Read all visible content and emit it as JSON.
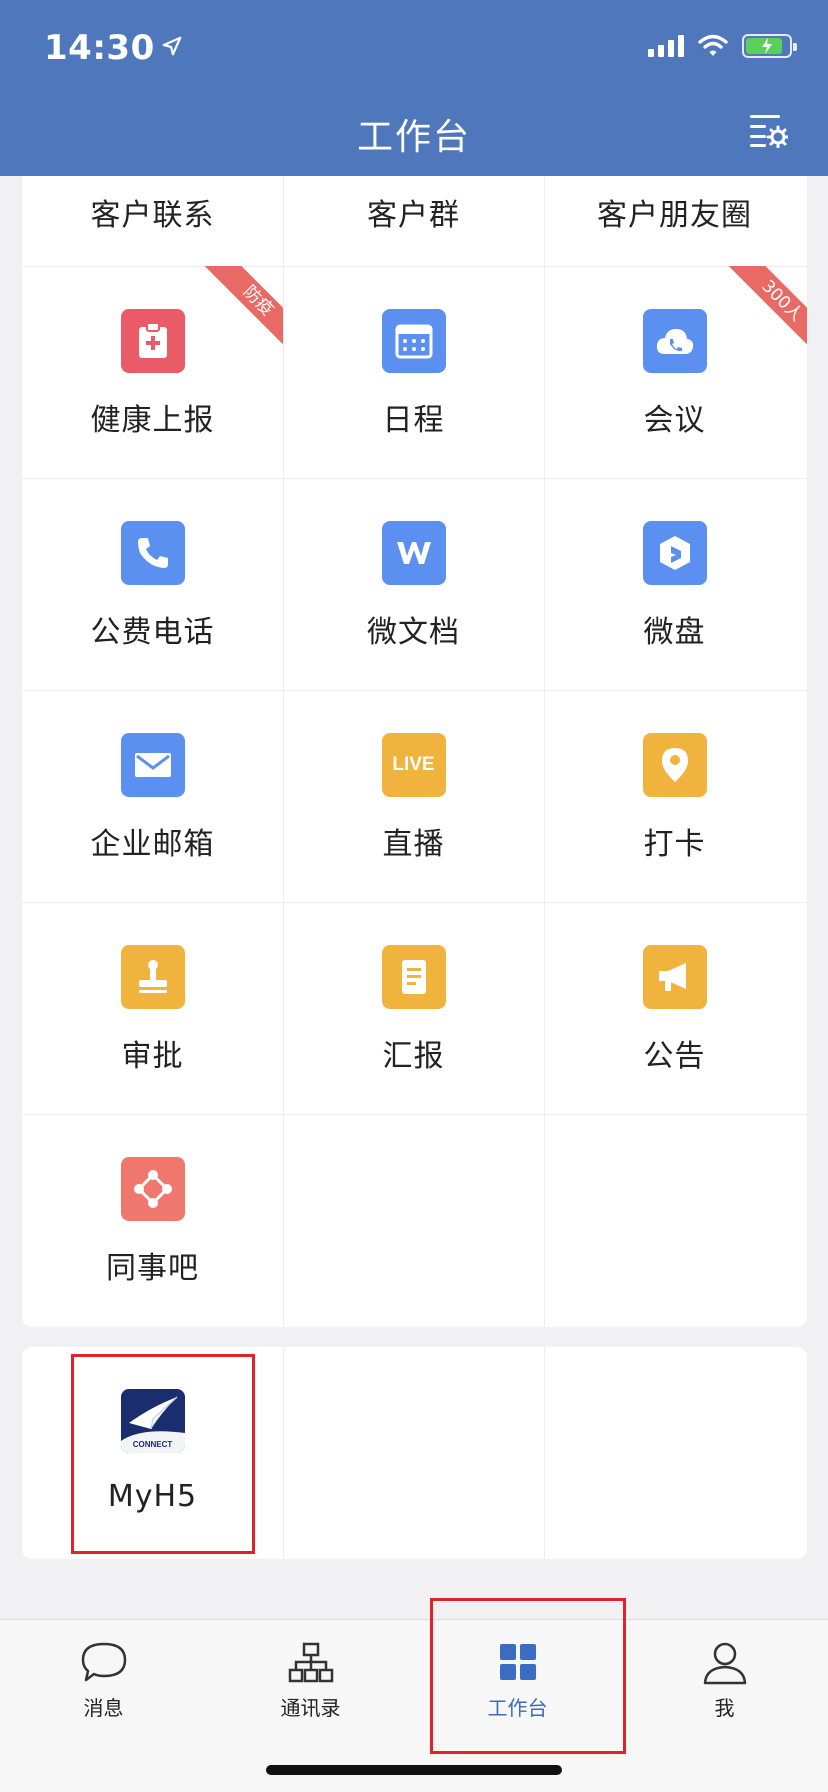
{
  "status_bar": {
    "time": "14:30"
  },
  "header": {
    "title": "工作台"
  },
  "top_row": [
    "客户联系",
    "客户群",
    "客户朋友圈"
  ],
  "apps": [
    {
      "label": "健康上报",
      "icon": "clipboard-plus-icon",
      "color": "#ea5a67",
      "badge": "防疫"
    },
    {
      "label": "日程",
      "icon": "calendar-icon",
      "color": "#5b8ff0"
    },
    {
      "label": "会议",
      "icon": "cloud-phone-icon",
      "color": "#5b8ff0",
      "badge": "300人"
    },
    {
      "label": "公费电话",
      "icon": "phone-icon",
      "color": "#5b8ff0"
    },
    {
      "label": "微文档",
      "icon": "w-doc-icon",
      "color": "#5b8ff0"
    },
    {
      "label": "微盘",
      "icon": "drive-icon",
      "color": "#5b8ff0"
    },
    {
      "label": "企业邮箱",
      "icon": "mail-icon",
      "color": "#5b8ff0"
    },
    {
      "label": "直播",
      "icon": "live-icon",
      "color": "#f0b33e",
      "icon_text": "LIVE"
    },
    {
      "label": "打卡",
      "icon": "location-pin-icon",
      "color": "#f0b33e"
    },
    {
      "label": "审批",
      "icon": "stamp-icon",
      "color": "#f0b33e"
    },
    {
      "label": "汇报",
      "icon": "report-icon",
      "color": "#f0b33e"
    },
    {
      "label": "公告",
      "icon": "megaphone-icon",
      "color": "#f0b33e"
    },
    {
      "label": "同事吧",
      "icon": "network-icon",
      "color": "#f0776d"
    }
  ],
  "custom_apps": [
    {
      "label": "MyH5",
      "icon": "paper-plane-connect-icon",
      "icon_text": "CONNECT"
    }
  ],
  "tab_bar": {
    "tabs": [
      {
        "label": "消息",
        "icon": "chat-bubble-icon"
      },
      {
        "label": "通讯录",
        "icon": "org-chart-icon"
      },
      {
        "label": "工作台",
        "icon": "grid-icon",
        "active": true
      },
      {
        "label": "我",
        "icon": "person-icon"
      }
    ]
  }
}
